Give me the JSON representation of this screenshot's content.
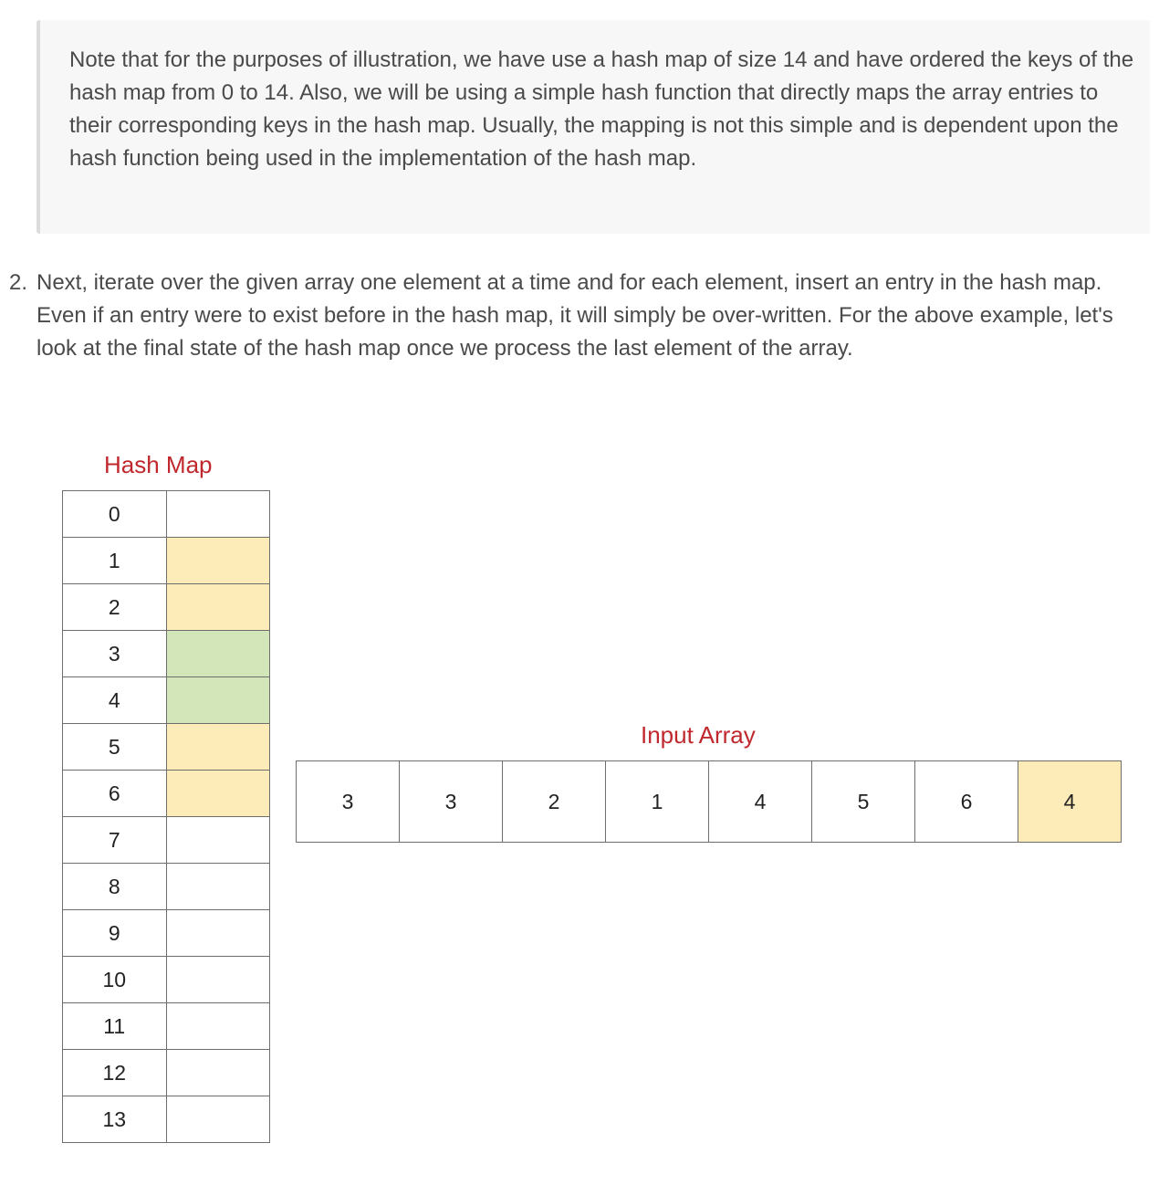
{
  "note": {
    "text": "Note that for the purposes of illustration, we have use a hash map of size 14 and have ordered the keys of the hash map from 0 to 14. Also, we will be using a simple hash function that directly maps the array entries to their corresponding keys in the hash map. Usually, the mapping is not this simple and is dependent upon the hash function being used in the implementation of the hash map."
  },
  "step": {
    "number": "2.",
    "text": "Next, iterate over the given array one element at a time and for each element, insert an entry in the hash map. Even if an entry were to exist before in the hash map, it will simply be over-written. For the above example, let's look at the final state of the hash map once we process the last element of the array."
  },
  "hash_map": {
    "title": "Hash Map",
    "rows": [
      {
        "key": "0",
        "fill": "none"
      },
      {
        "key": "1",
        "fill": "yellow"
      },
      {
        "key": "2",
        "fill": "yellow"
      },
      {
        "key": "3",
        "fill": "green"
      },
      {
        "key": "4",
        "fill": "green"
      },
      {
        "key": "5",
        "fill": "yellow"
      },
      {
        "key": "6",
        "fill": "yellow"
      },
      {
        "key": "7",
        "fill": "none"
      },
      {
        "key": "8",
        "fill": "none"
      },
      {
        "key": "9",
        "fill": "none"
      },
      {
        "key": "10",
        "fill": "none"
      },
      {
        "key": "11",
        "fill": "none"
      },
      {
        "key": "12",
        "fill": "none"
      },
      {
        "key": "13",
        "fill": "none"
      }
    ]
  },
  "input_array": {
    "title": "Input Array",
    "values": [
      "3",
      "3",
      "2",
      "1",
      "4",
      "5",
      "6",
      "4"
    ],
    "highlighted_index": 7
  },
  "colors": {
    "title_red": "#c0282d",
    "yellow": "#fdecb8",
    "green": "#d3e6b9"
  }
}
